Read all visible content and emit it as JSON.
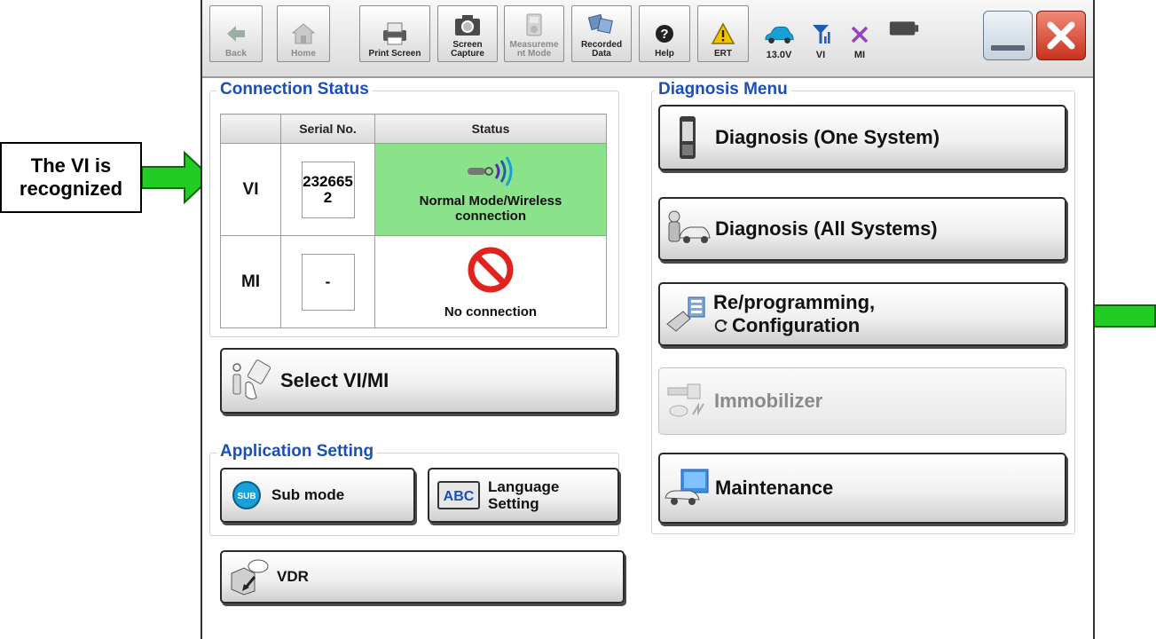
{
  "annotation": {
    "callout_line1": "The VI is",
    "callout_line2": "recognized",
    "arrow_color": "#22cc22"
  },
  "toolbar": {
    "back": "Back",
    "home": "Home",
    "print_screen": "Print Screen",
    "screen_capture": "Screen\nCapture",
    "measurement_mode": "Measureme\nnt Mode",
    "recorded_data": "Recorded\nData",
    "help": "Help",
    "ert": "ERT",
    "voltage": "13.0V",
    "vi": "VI",
    "mi": "MI"
  },
  "connection_status": {
    "title": "Connection Status",
    "col_serial": "Serial No.",
    "col_status": "Status",
    "vi_label": "VI",
    "vi_serial": "232665\n2",
    "vi_status": "Normal Mode/Wireless connection",
    "mi_label": "MI",
    "mi_serial": "-",
    "mi_status": "No connection"
  },
  "select_vi_mi": "Select VI/MI",
  "application_setting": {
    "title": "Application Setting",
    "sub_mode": "Sub mode",
    "sub_badge": "SUB",
    "language": "Language\nSetting",
    "abc": "ABC"
  },
  "vdr": "VDR",
  "diagnosis_menu": {
    "title": "Diagnosis Menu",
    "one_system": "Diagnosis (One System)",
    "all_systems": "Diagnosis (All Systems)",
    "reprogramming_1": "Re/programming,",
    "reprogramming_2": "Configuration",
    "immobilizer": "Immobilizer",
    "maintenance": "Maintenance"
  },
  "colors": {
    "accent_blue": "#1b4fb8",
    "connected_green": "#8ae38a",
    "error_red": "#e0231c"
  }
}
